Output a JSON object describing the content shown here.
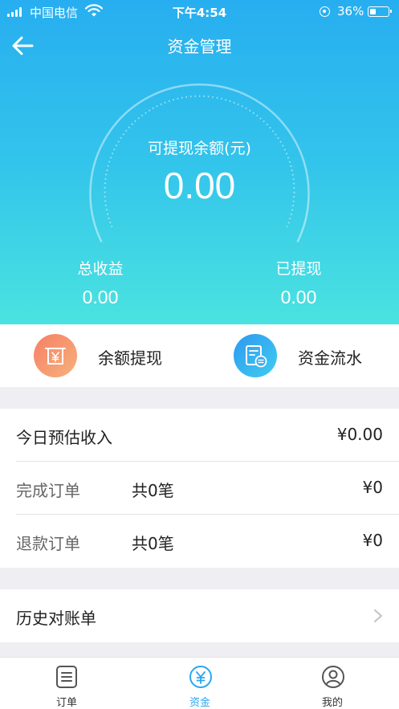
{
  "status_bar": {
    "carrier": "中国电信",
    "time": "下午4:54",
    "battery_percent": "36%",
    "battery_level": 0.36
  },
  "nav": {
    "title": "资金管理"
  },
  "balance": {
    "label": "可提现余额(元)",
    "value": "0.00"
  },
  "stats": {
    "total_income": {
      "label": "总收益",
      "value": "0.00"
    },
    "withdrawn": {
      "label": "已提现",
      "value": "0.00"
    }
  },
  "actions": {
    "withdraw": {
      "label": "余额提现",
      "icon": "yuan-receipt-icon"
    },
    "flow": {
      "label": "资金流水",
      "icon": "ledger-icon"
    }
  },
  "today": {
    "title": "今日预估收入",
    "amount": "¥0.00",
    "rows": [
      {
        "title": "完成订单",
        "count": "共0笔",
        "amount": "¥0"
      },
      {
        "title": "退款订单",
        "count": "共0笔",
        "amount": "¥0"
      }
    ]
  },
  "history": {
    "title": "历史对账单",
    "icon": "chevron-right-icon"
  },
  "tabs": [
    {
      "label": "订单",
      "icon": "order-list-icon",
      "active": false
    },
    {
      "label": "资金",
      "icon": "yuan-circle-icon",
      "active": true
    },
    {
      "label": "我的",
      "icon": "user-profile-icon",
      "active": false
    }
  ],
  "colors": {
    "accent": "#2aa6f2",
    "hero_top": "#27aef0",
    "hero_bottom": "#4be3e0",
    "withdraw_icon": "#f57f66",
    "flow_icon": "#2f98f0"
  }
}
